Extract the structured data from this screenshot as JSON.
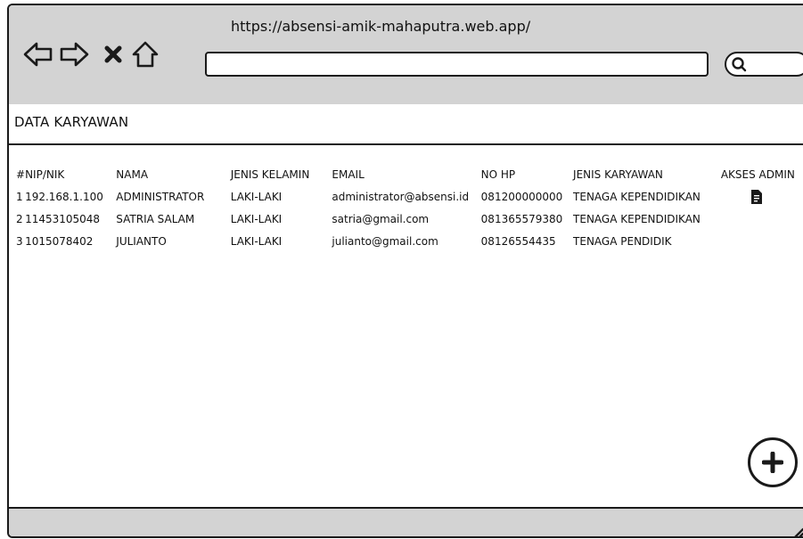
{
  "browser": {
    "url": "https://absensi-amik-mahaputra.web.app/",
    "nav_icons": [
      "back-arrow-icon",
      "forward-arrow-icon",
      "close-icon",
      "home-icon"
    ],
    "search_icon": "search-icon"
  },
  "page": {
    "title": "DATA KARYAWAN"
  },
  "table": {
    "headers": {
      "no": "#",
      "nip": "NIP/NIK",
      "nama": "NAMA",
      "jenis_kelamin": "JENIS KELAMIN",
      "email": "EMAIL",
      "no_hp": "NO HP",
      "jenis_karyawan": "JENIS KARYAWAN",
      "akses_admin": "AKSES ADMIN"
    },
    "rows": [
      {
        "no": "1",
        "nip": "192.168.1.100",
        "nama": "ADMINISTRATOR",
        "jenis_kelamin": "LAKI-LAKI",
        "email": "administrator@absensi.id",
        "no_hp": "081200000000",
        "jenis_karyawan": "TENAGA KEPENDIDIKAN",
        "akses_admin_icon": "document-icon"
      },
      {
        "no": "2",
        "nip": "11453105048",
        "nama": "SATRIA SALAM",
        "jenis_kelamin": "LAKI-LAKI",
        "email": "satria@gmail.com",
        "no_hp": "081365579380",
        "jenis_karyawan": "TENAGA KEPENDIDIKAN",
        "akses_admin_icon": ""
      },
      {
        "no": "3",
        "nip": "1015078402",
        "nama": "JULIANTO",
        "jenis_kelamin": "LAKI-LAKI",
        "email": "julianto@gmail.com",
        "no_hp": "08126554435",
        "jenis_karyawan": "TENAGA PENDIDIK",
        "akses_admin_icon": ""
      }
    ]
  },
  "actions": {
    "add_icon": "plus-icon"
  },
  "colors": {
    "chrome": "#d3d3d3",
    "ink": "#1a1a1a",
    "background": "#ffffff"
  }
}
